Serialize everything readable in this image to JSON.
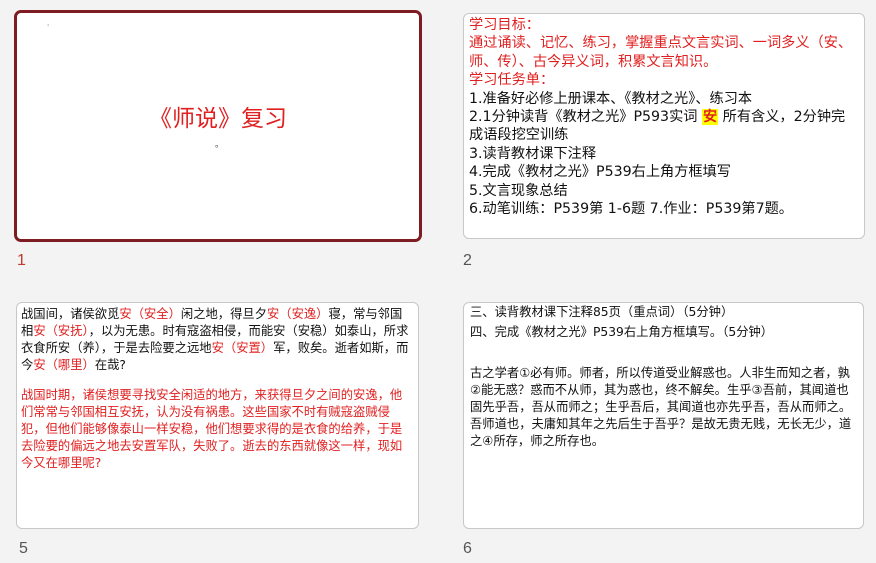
{
  "slides": [
    {
      "number": "1",
      "selected": true,
      "title": "《师说》复习",
      "marks": [
        "'",
        "。"
      ]
    },
    {
      "number": "2",
      "objective_heading": "学习目标：",
      "objective_text": "通过诵读、记忆、练习，掌握重点文言实词、一词多义（安、师、传）、古今异义词，积累文言知识。",
      "task_heading": "学习任务单：",
      "task1": "1.准备好必修上册课本、《教材之光》、练习本",
      "task2_pre": "2.1分钟读背《教材之光》P593实词 ",
      "task2_highlight": "安",
      "task2_post": " 所有含义，2分钟完成语段挖空训练",
      "task3": "3.读背教材课下注释",
      "task4": "4.完成《教材之光》P539右上角方框填写",
      "task5": "5.文言现象总结",
      "task6": "6.动笔训练：P539第 1-6题   7.作业：P539第7题。"
    },
    {
      "number": "5",
      "p1": [
        {
          "t": "战国间，诸侯欲觅",
          "red": false
        },
        {
          "t": "安（安全）",
          "red": true
        },
        {
          "t": "闲之地，得旦夕",
          "red": false
        },
        {
          "t": "安（安逸）",
          "red": true
        },
        {
          "t": "寝，常与邻国相",
          "red": false
        },
        {
          "t": "安（安抚）",
          "red": true
        },
        {
          "t": "，以为无患。时有寇盗相侵，而能安（安稳）如泰山，所求衣食所安（养），于是去险要之远地",
          "red": false
        },
        {
          "t": "安（安置）",
          "red": true
        },
        {
          "t": "军，败矣。逝者如斯，而今",
          "red": false
        },
        {
          "t": "安（哪里）",
          "red": true
        },
        {
          "t": "在哉?",
          "red": false
        }
      ],
      "p2": "战国时期，诸侯想要寻找安全闲适的地方，来获得旦夕之间的安逸，他们常常与邻国相互安抚，认为没有祸患。这些国家不时有贼寇盗贼侵犯，但他们能够像泰山一样安稳，他们想要求得的是衣食的给养，于是去险要的偏远之地去安置军队，失败了。逝去的东西就像这一样，现如今又在哪里呢?"
    },
    {
      "number": "6",
      "task3": "三、读背教材课下注释85页（重点词）（5分钟）",
      "task4": "四、完成《教材之光》P539右上角方框填写。（5分钟）",
      "passage": "古之学者①必有师。师者，所以传道受业解惑也。人非生而知之者，孰②能无惑？惑而不从师，其为惑也，终不解矣。生乎③吾前，其闻道也固先乎吾，吾从而师之；生乎吾后，其闻道也亦先乎吾，吾从而师之。吾师道也，夫庸知其年之先后生于吾乎？是故无贵无贱，无长无少，道之④所存，师之所存也。"
    }
  ],
  "colors": {
    "accent_red": "#e02020",
    "selected_border": "#7d1c22"
  }
}
